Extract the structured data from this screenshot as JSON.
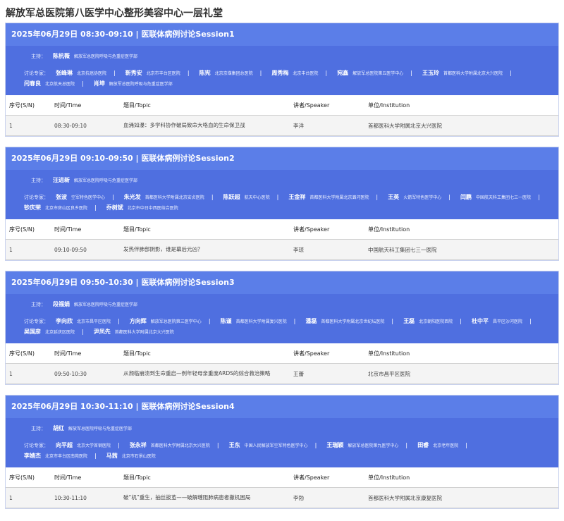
{
  "page_title": "解放军总医院第八医学中心整形美容中心一层礼堂",
  "labels": {
    "host": "主持：",
    "discussants": "讨论专家："
  },
  "table_headers": [
    "序号(S/N)",
    "时间/Time",
    "题目/Topic",
    "讲者/Speaker",
    "单位/Institution"
  ],
  "sessions": [
    {
      "title": "2025年06月29日 08:30-09:10 | 医联体病例讨论Session1",
      "host": {
        "name": "陈杭薇",
        "org": "解放军总医院呼吸与危重症医学部"
      },
      "experts": [
        {
          "name": "张峰琳",
          "org": "北京抗癌协医院"
        },
        {
          "name": "靳秀安",
          "org": "北京市丰台区医院"
        },
        {
          "name": "陈宪",
          "org": "北京京煤集团总医院"
        },
        {
          "name": "周秀梅",
          "org": "北京丰台医院"
        },
        {
          "name": "宛鑫",
          "org": "解放军总医院第五医学中心"
        },
        {
          "name": "王玉玲",
          "org": "首都医科大学附属北京大兴医院"
        },
        {
          "name": "闫春良",
          "org": "北京航天总医院"
        },
        {
          "name": "肖坤",
          "org": "解放军总医院呼吸与危重症医学部"
        }
      ],
      "rows": [
        {
          "no": "1",
          "time": "08:30-09:10",
          "topic": "血涌如瀑：多学科协作破局致命大咯血的生命保卫战",
          "speaker": "李洋",
          "inst": "首都医科大学附属北京大兴医院"
        }
      ]
    },
    {
      "title": "2025年06月29日 09:10-09:50 | 医联体病例讨论Session2",
      "host": {
        "name": "汪进新",
        "org": "解放军总医院呼吸与危重症医学部"
      },
      "experts": [
        {
          "name": "张波",
          "org": "空军特色医学中心"
        },
        {
          "name": "朱光发",
          "org": "首都医科大学附属北京安贞医院"
        },
        {
          "name": "陈跃超",
          "org": "航天中心医院"
        },
        {
          "name": "王金祥",
          "org": "首都医科大学附属北京潞河医院"
        },
        {
          "name": "王英",
          "org": "火箭军特色医学中心"
        },
        {
          "name": "闫鹏",
          "org": "中国航天科工集团七三一医院"
        },
        {
          "name": "钞庆荣",
          "org": "北京市房山区良乡医院"
        },
        {
          "name": "乔树斌",
          "org": "北京市中日中西医结合医院"
        }
      ],
      "rows": [
        {
          "no": "1",
          "time": "09:10-09:50",
          "topic": "发热伴肺部阴影，谁是幕后元凶？",
          "speaker": "李琼",
          "inst": "中国航天科工集团七三一医院"
        }
      ]
    },
    {
      "title": "2025年06月29日 09:50-10:30 | 医联体病例讨论Session3",
      "host": {
        "name": "段福娟",
        "org": "解放军总医院呼吸与危重症医学部"
      },
      "experts": [
        {
          "name": "李向欣",
          "org": "北京市昌平区医院"
        },
        {
          "name": "方向辉",
          "org": "解放军总医院第三医学中心"
        },
        {
          "name": "陈谨",
          "org": "首都医科大学附属复兴医院"
        },
        {
          "name": "潘磊",
          "org": "首都医科大学附属北京世纪坛医院"
        },
        {
          "name": "王磊",
          "org": "北京朝阳医院西院"
        },
        {
          "name": "杜中平",
          "org": "昌平区沙河医院"
        },
        {
          "name": "吴国彦",
          "org": "北京延庆区医院"
        },
        {
          "name": "尹凤先",
          "org": "首都医科大学附属北京大兴医院"
        }
      ],
      "rows": [
        {
          "no": "1",
          "time": "09:50-10:30",
          "topic": "从濒临崩溃到生命重启—例年轻母亲重度ARDS的综合救治策略",
          "speaker": "王蕾",
          "inst": "北京市昌平区医院"
        }
      ]
    },
    {
      "title": "2025年06月29日 10:30-11:10 | 医联体病例讨论Session4",
      "host": {
        "name": "胡红",
        "org": "解放军总医院呼吸与危重症医学部"
      },
      "experts": [
        {
          "name": "向平超",
          "org": "北京大学首钢医院"
        },
        {
          "name": "张永祥",
          "org": "首都医科大学附属北京大兴医院"
        },
        {
          "name": "王东",
          "org": "中国人民解放军空军特色医学中心"
        },
        {
          "name": "王瑞颖",
          "org": "解放军总医院第九医学中心"
        },
        {
          "name": "田睿",
          "org": "北京老年医院"
        },
        {
          "name": "李婧杰",
          "org": "北京市丰台区南苑医院"
        },
        {
          "name": "马茜",
          "org": "北京市石景山医院"
        }
      ],
      "rows": [
        {
          "no": "1",
          "time": "10:30-11:10",
          "topic": "破“机”重生，抽丝拔茧——破解缠阻肺病患者撤机困局",
          "speaker": "李勃",
          "inst": "首都医科大学附属北京康复医院"
        }
      ]
    }
  ]
}
